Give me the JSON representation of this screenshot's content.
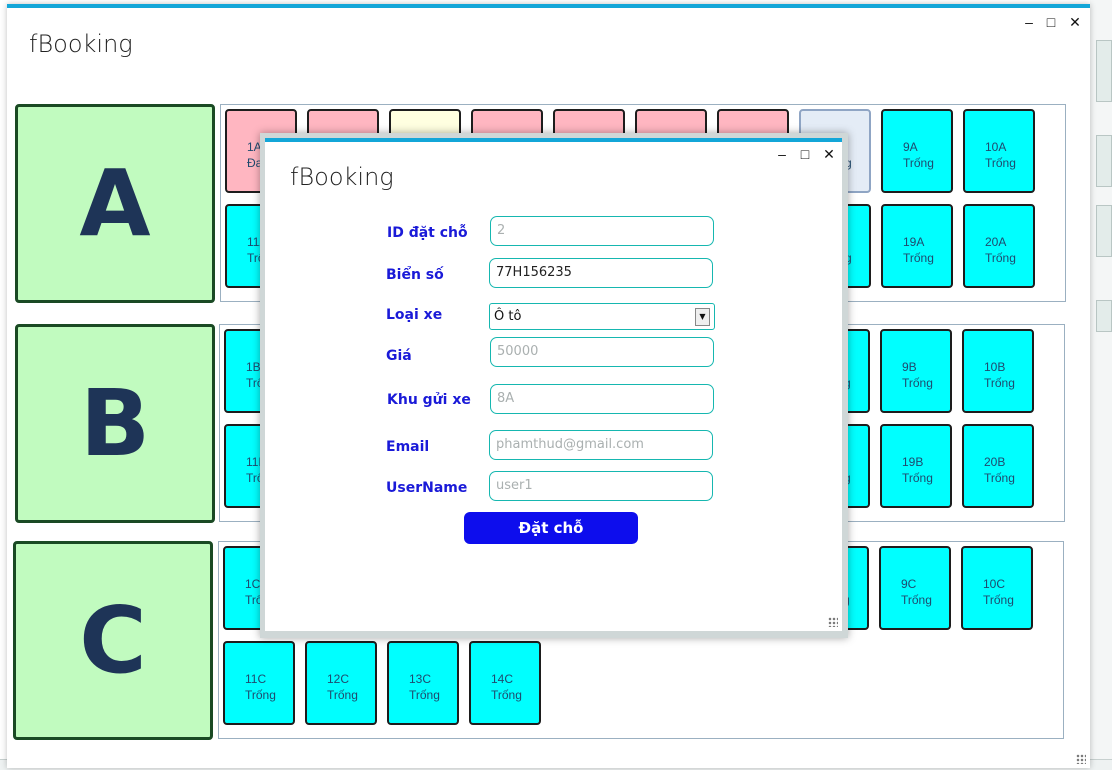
{
  "window": {
    "title": "fBooking",
    "minimize": "–",
    "maximize": "□",
    "close": "✕"
  },
  "zones": [
    {
      "letter": "A"
    },
    {
      "letter": "B"
    },
    {
      "letter": "C"
    }
  ],
  "slots": {
    "s1A": {
      "id": "1A",
      "status": "Đang"
    },
    "s9A": {
      "id": "9A",
      "status": "Trống"
    },
    "s10A": {
      "id": "10A",
      "status": "Trống"
    },
    "s8A_status": "g",
    "s11A": {
      "id": "11A",
      "status": "Trố"
    },
    "s19A": {
      "id": "19A",
      "status": "Trống"
    },
    "s20A": {
      "id": "20A",
      "status": "Trống"
    },
    "s18A_status": "g",
    "s1B": {
      "id": "1B",
      "status": "Trố"
    },
    "s9B": {
      "id": "9B",
      "status": "Trống"
    },
    "s10B": {
      "id": "10B",
      "status": "Trống"
    },
    "s8B_status": "g",
    "s11B": {
      "id": "11B",
      "status": "Trố"
    },
    "s19B": {
      "id": "19B",
      "status": "Trống"
    },
    "s20B": {
      "id": "20B",
      "status": "Trống"
    },
    "s18B_status": "g",
    "s1C": {
      "id": "1C",
      "status": "Trố"
    },
    "s9C": {
      "id": "9C",
      "status": "Trống"
    },
    "s10C": {
      "id": "10C",
      "status": "Trống"
    },
    "s8C_status": "g",
    "s11C": {
      "id": "11C",
      "status": "Trống"
    },
    "s12C": {
      "id": "12C",
      "status": "Trống"
    },
    "s13C": {
      "id": "13C",
      "status": "Trống"
    },
    "s14C": {
      "id": "14C",
      "status": "Trống"
    }
  },
  "dialog": {
    "title": "fBooking",
    "minimize": "–",
    "maximize": "□",
    "close": "✕",
    "fields": {
      "id_label": "ID đặt chỗ",
      "id_value": "2",
      "plate_label": "Biển số",
      "plate_value": "77H156235",
      "type_label": "Loại xe",
      "type_value": "Ô tô",
      "price_label": "Giá",
      "price_value": "50000",
      "zone_label": "Khu gửi xe",
      "zone_value": "8A",
      "email_label": "Email",
      "email_value": "phamthud@gmail.com",
      "user_label": "UserName",
      "user_value": "user1"
    },
    "book_button": "Đặt chỗ"
  },
  "colors": {
    "accent": "#13a6d8",
    "slot_free": "#00ffff",
    "slot_busy": "#ffb6c1",
    "zone_bg": "#c1fbbf",
    "button": "#0d0ded"
  }
}
